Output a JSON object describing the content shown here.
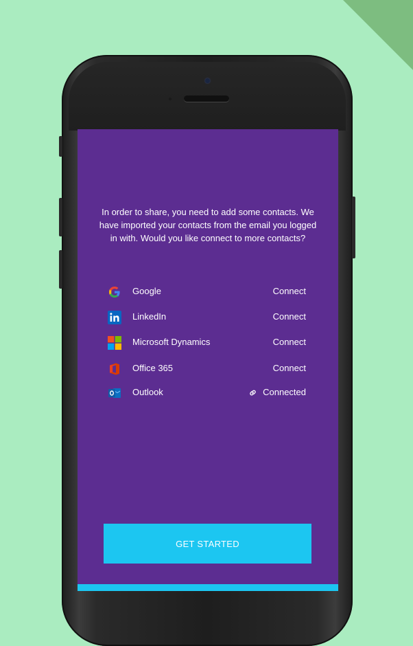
{
  "intro_text": "In order to share, you need to add some contacts. We have imported your contacts from the email you logged in with. Would you like connect to more contacts?",
  "providers": [
    {
      "name": "Google",
      "action": "Connect",
      "icon": "google-icon"
    },
    {
      "name": "LinkedIn",
      "action": "Connect",
      "icon": "linkedin-icon"
    },
    {
      "name": "Microsoft Dynamics",
      "action": "Connect",
      "icon": "microsoft-dynamics-icon"
    },
    {
      "name": "Office 365",
      "action": "Connect",
      "icon": "office-365-icon"
    },
    {
      "name": "Outlook",
      "action": "Connected",
      "icon": "outlook-icon",
      "status_icon": "link-icon"
    }
  ],
  "cta_label": "GET STARTED",
  "colors": {
    "background": "#aaecc0",
    "shadow": "#7dbd80",
    "screen": "#5c2d91",
    "accent": "#1cc6f1",
    "text": "#ffffff"
  }
}
